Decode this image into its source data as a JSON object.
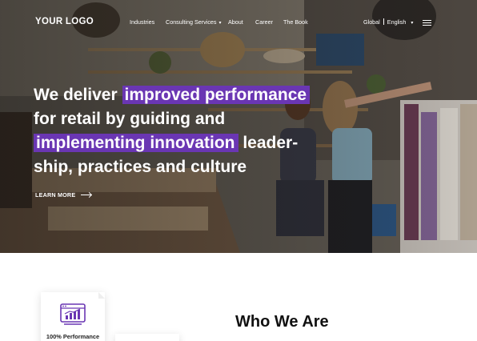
{
  "nav": {
    "logo": "YOUR LOGO",
    "items": [
      {
        "label": "Industries"
      },
      {
        "label": "Consulting Services",
        "dropdown": true
      },
      {
        "label": "About"
      },
      {
        "label": "Career"
      },
      {
        "label": "The Book"
      }
    ],
    "region": "Global",
    "language": "English",
    "chevron": "▾"
  },
  "hero": {
    "line1_plain": "We deliver ",
    "line1_mark": "improved performance",
    "line2": "for retail by guiding and",
    "line3_mark": "implementing innovation",
    "line3_plain": " leader-",
    "line4": "ship, practices and culture",
    "cta": "LEARN MORE"
  },
  "features": {
    "card1_label": "100% Performance",
    "card1_icon": "performance-chart-icon"
  },
  "section": {
    "title": "Who We Are"
  },
  "colors": {
    "accent": "#6a36b3",
    "text_dark": "#111111"
  }
}
